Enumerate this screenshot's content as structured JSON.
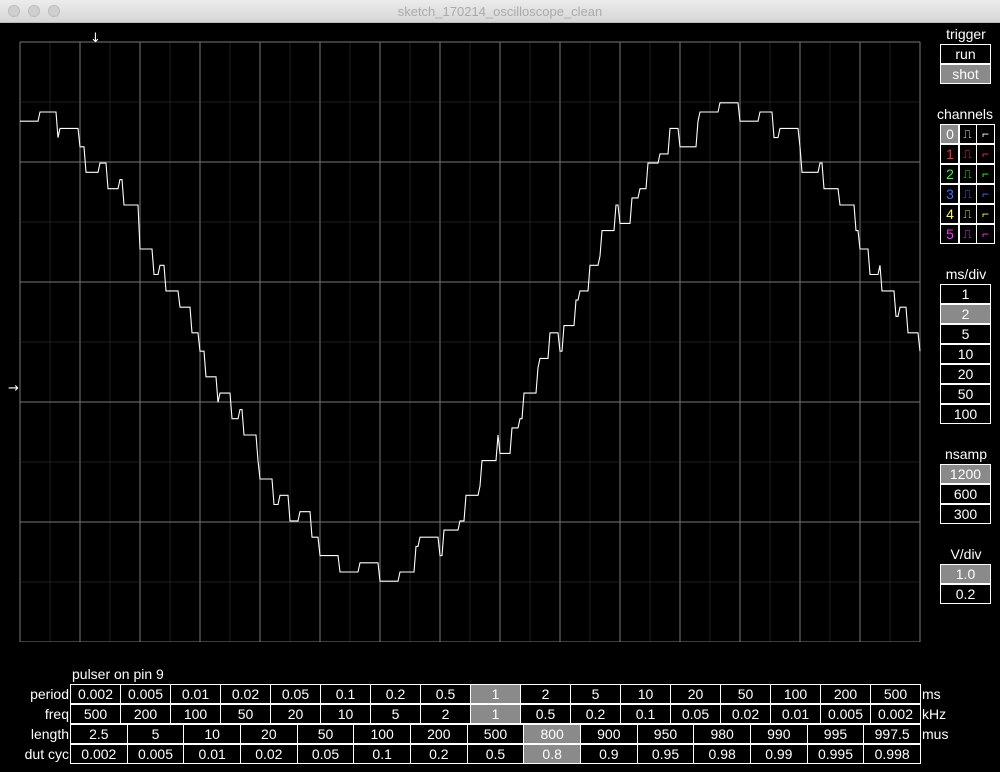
{
  "window": {
    "title": "sketch_170214_oscilloscope_clean"
  },
  "scope": {
    "grid_cols": 15,
    "grid_rows": 5,
    "trace_color": "#ffffff",
    "grid_color": "#777777",
    "trigger_marker_top": "↓",
    "trigger_marker_left": "→"
  },
  "trigger": {
    "header": "trigger",
    "buttons": [
      {
        "label": "run",
        "selected": false
      },
      {
        "label": "shot",
        "selected": true
      }
    ]
  },
  "channels": {
    "header": "channels",
    "items": [
      {
        "id": "0",
        "color": "#ffffff",
        "selected": true
      },
      {
        "id": "1",
        "color": "#ff3030",
        "selected": false
      },
      {
        "id": "2",
        "color": "#30ff30",
        "selected": false
      },
      {
        "id": "3",
        "color": "#4070ff",
        "selected": false
      },
      {
        "id": "4",
        "color": "#ffff30",
        "selected": false
      },
      {
        "id": "5",
        "color": "#ff30ff",
        "selected": false
      }
    ],
    "rise_glyph": "⎍",
    "fall_glyph": "⎍"
  },
  "msdiv": {
    "header": "ms/div",
    "options": [
      "1",
      "2",
      "5",
      "10",
      "20",
      "50",
      "100"
    ],
    "selected": "2"
  },
  "nsamp": {
    "header": "nsamp",
    "options": [
      "1200",
      "600",
      "300"
    ],
    "selected": "1200"
  },
  "vdiv": {
    "header": "V/div",
    "options": [
      "1.0",
      "0.2"
    ],
    "selected": "1.0"
  },
  "pulser": {
    "title": "pulser on pin 9",
    "rows": [
      {
        "label": "period",
        "unit": "ms",
        "selected_index": 8,
        "values": [
          "0.002",
          "0.005",
          "0.01",
          "0.02",
          "0.05",
          "0.1",
          "0.2",
          "0.5",
          "1",
          "2",
          "5",
          "10",
          "20",
          "50",
          "100",
          "200",
          "500"
        ]
      },
      {
        "label": "freq",
        "unit": "kHz",
        "selected_index": 8,
        "values": [
          "500",
          "200",
          "100",
          "50",
          "20",
          "10",
          "5",
          "2",
          "1",
          "0.5",
          "0.2",
          "0.1",
          "0.05",
          "0.02",
          "0.01",
          "0.005",
          "0.002"
        ]
      },
      {
        "label": "length",
        "unit": "mus",
        "selected_index": 8,
        "values": [
          "2.5",
          "5",
          "10",
          "20",
          "50",
          "100",
          "200",
          "500",
          "800",
          "900",
          "950",
          "980",
          "990",
          "995",
          "997.5"
        ]
      },
      {
        "label": "dut cyc",
        "unit": "",
        "selected_index": 8,
        "values": [
          "0.002",
          "0.005",
          "0.01",
          "0.02",
          "0.05",
          "0.1",
          "0.2",
          "0.5",
          "0.8",
          "0.9",
          "0.95",
          "0.98",
          "0.99",
          "0.995",
          "0.998"
        ]
      }
    ]
  }
}
